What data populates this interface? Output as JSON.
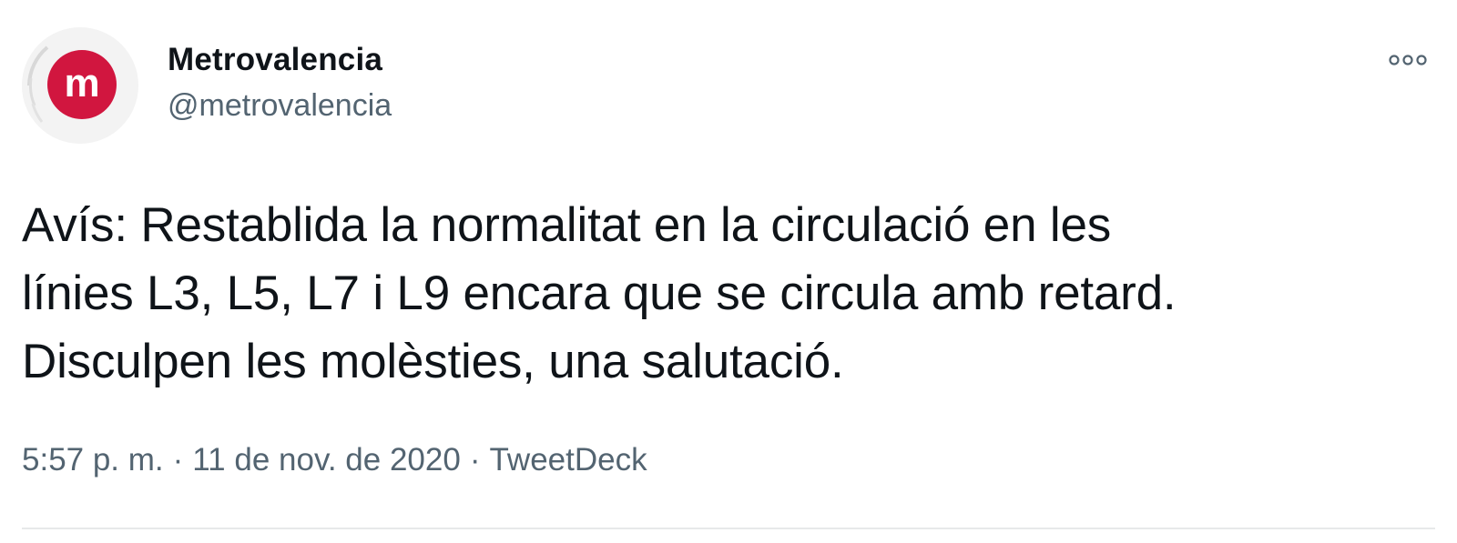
{
  "tweet": {
    "author": {
      "display_name": "Metrovalencia",
      "handle": "@metrovalencia",
      "avatar_icon": "metrovalencia-logo-icon",
      "avatar_letter": "m",
      "brand_color": "#d1163f"
    },
    "more_icon": "more-options-icon",
    "text": "Avís: Restablida la normalitat en la circulació en les\nlínies L3, L5, L7 i L9 encara que se circula amb retard.\nDisculpen les molèsties, una salutació.",
    "time": "5:57 p. m.",
    "separator": "·",
    "date": "11 de nov. de 2020",
    "source": "TweetDeck"
  }
}
